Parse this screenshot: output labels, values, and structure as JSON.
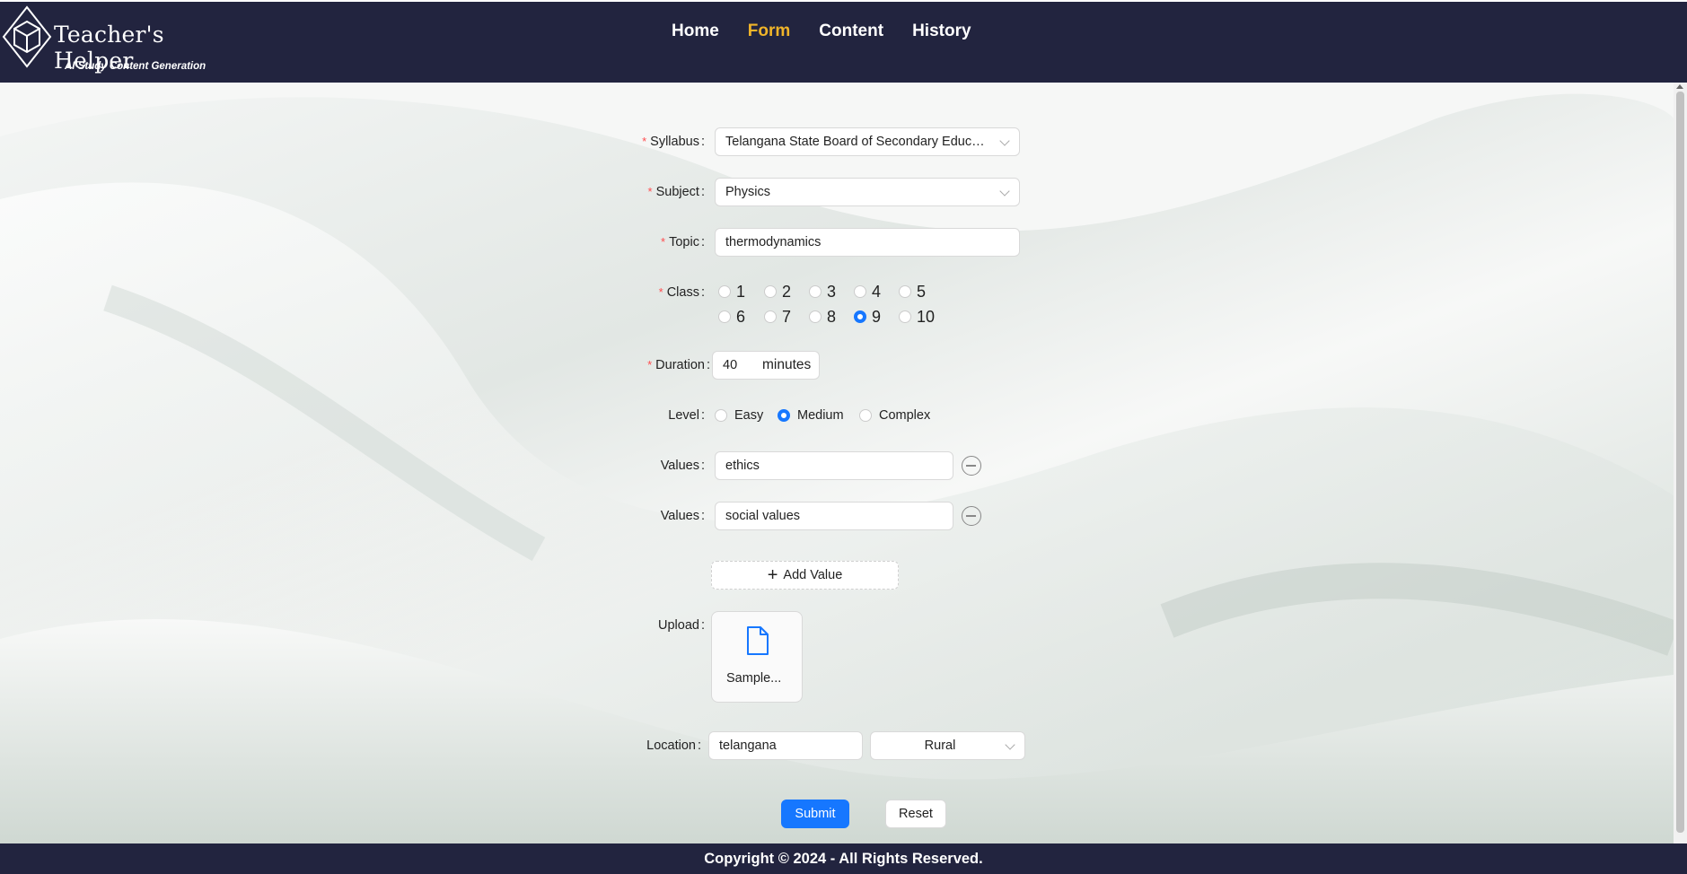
{
  "header": {
    "logo_title": "Teacher's Helper",
    "logo_subtitle": "AI Study Content Generation",
    "nav": [
      "Home",
      "Form",
      "Content",
      "History"
    ],
    "active_nav": "Form"
  },
  "form": {
    "syllabus": {
      "label": "Syllabus",
      "value": "Telangana State Board of Secondary Educati..."
    },
    "subject": {
      "label": "Subject",
      "value": "Physics"
    },
    "topic": {
      "label": "Topic",
      "value": "thermodynamics"
    },
    "class": {
      "label": "Class",
      "options": [
        "1",
        "2",
        "3",
        "4",
        "5",
        "6",
        "7",
        "8",
        "9",
        "10"
      ],
      "selected": "9"
    },
    "duration": {
      "label": "Duration",
      "value": "40",
      "unit": "minutes"
    },
    "level": {
      "label": "Level",
      "options": [
        "Easy",
        "Medium",
        "Complex"
      ],
      "selected": "Medium"
    },
    "values": [
      {
        "label": "Values",
        "value": "ethics"
      },
      {
        "label": "Values",
        "value": "social values"
      }
    ],
    "add_value_label": "Add Value",
    "upload": {
      "label": "Upload",
      "file_name": "Sample..."
    },
    "location": {
      "label": "Location",
      "value": "telangana",
      "area": "Rural"
    },
    "submit_label": "Submit",
    "reset_label": "Reset"
  },
  "footer": {
    "copyright": "Copyright © 2024 - All Rights Reserved."
  },
  "colors": {
    "header_bg": "#22243f",
    "active_nav": "#f0b429",
    "primary": "#1677ff",
    "required": "#ff4d4f"
  }
}
